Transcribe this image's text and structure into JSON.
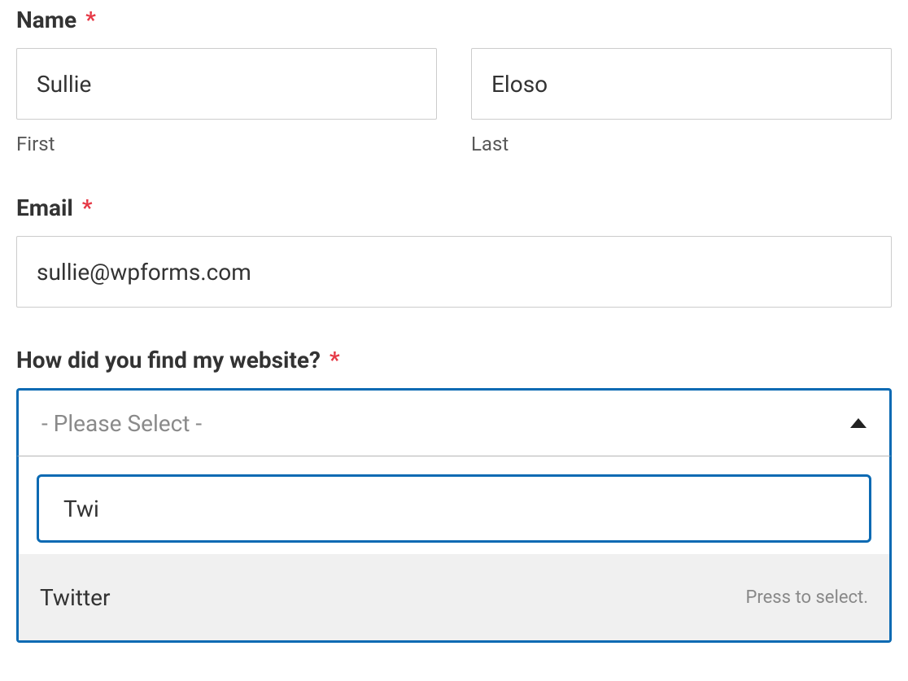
{
  "fields": {
    "name": {
      "label": "Name",
      "required": "*",
      "first": {
        "value": "Sullie",
        "sublabel": "First"
      },
      "last": {
        "value": "Eloso",
        "sublabel": "Last"
      }
    },
    "email": {
      "label": "Email",
      "required": "*",
      "value": "sullie@wpforms.com"
    },
    "source": {
      "label": "How did you find my website?",
      "required": "*",
      "placeholder": "- Please Select -",
      "search_value": "Twi",
      "option": {
        "text": "Twitter",
        "hint": "Press to select."
      }
    }
  }
}
